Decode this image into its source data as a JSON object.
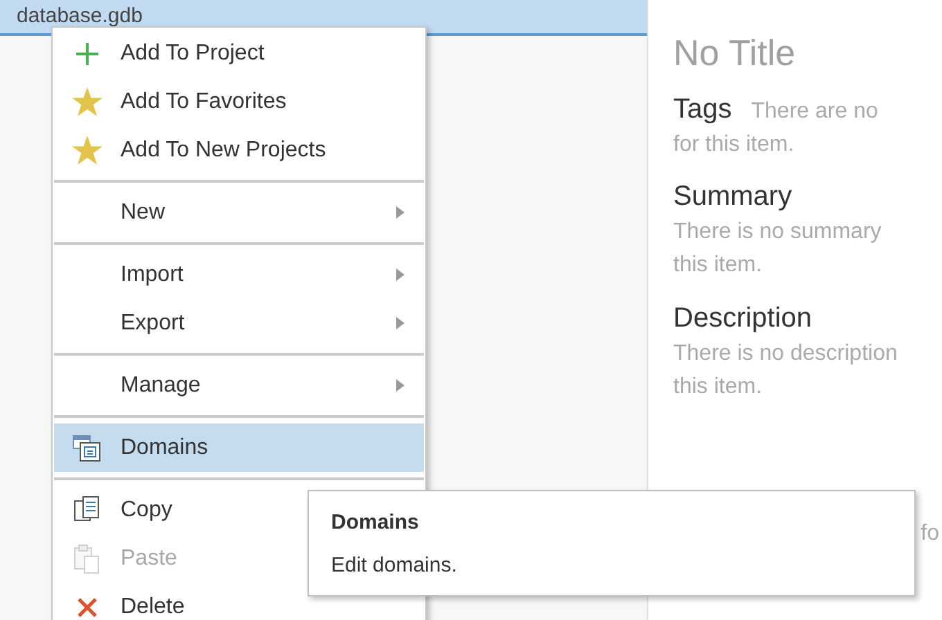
{
  "catalog": {
    "selected_item": {
      "label": "database.gdb",
      "selected": true
    }
  },
  "context_menu": {
    "groups": [
      {
        "items": [
          {
            "label": "Add To Project",
            "kind": "add",
            "submenu": false,
            "disabled": false,
            "selected": false
          },
          {
            "label": "Add To Favorites",
            "kind": "favorite",
            "submenu": false,
            "disabled": false,
            "selected": false
          },
          {
            "label": "Add To New Projects",
            "kind": "favorite",
            "submenu": false,
            "disabled": false,
            "selected": false
          }
        ]
      },
      {
        "items": [
          {
            "label": "New",
            "kind": "plain",
            "submenu": true,
            "disabled": false,
            "selected": false
          }
        ]
      },
      {
        "items": [
          {
            "label": "Import",
            "kind": "plain",
            "submenu": true,
            "disabled": false,
            "selected": false
          },
          {
            "label": "Export",
            "kind": "plain",
            "submenu": true,
            "disabled": false,
            "selected": false
          }
        ]
      },
      {
        "items": [
          {
            "label": "Manage",
            "kind": "plain",
            "submenu": true,
            "disabled": false,
            "selected": false
          }
        ]
      },
      {
        "items": [
          {
            "label": "Domains",
            "kind": "domains",
            "submenu": false,
            "disabled": false,
            "selected": true
          }
        ]
      },
      {
        "items": [
          {
            "label": "Copy",
            "kind": "copy",
            "submenu": false,
            "disabled": false,
            "selected": false
          },
          {
            "label": "Paste",
            "kind": "paste",
            "submenu": false,
            "disabled": true,
            "selected": false
          },
          {
            "label": "Delete",
            "kind": "delete",
            "submenu": false,
            "disabled": false,
            "selected": false
          }
        ]
      }
    ]
  },
  "tooltip": {
    "title": "Domains",
    "text": "Edit domains."
  },
  "details": {
    "title": "No Title",
    "tags": {
      "heading": "Tags",
      "text": [
        "There are no",
        "for this item."
      ]
    },
    "sections": [
      {
        "heading": "Summary",
        "text": [
          "There is no summary",
          "this item."
        ]
      },
      {
        "heading": "Description",
        "text": [
          "There is no description",
          "this item."
        ]
      },
      {
        "text": [
          "fo"
        ]
      }
    ]
  }
}
